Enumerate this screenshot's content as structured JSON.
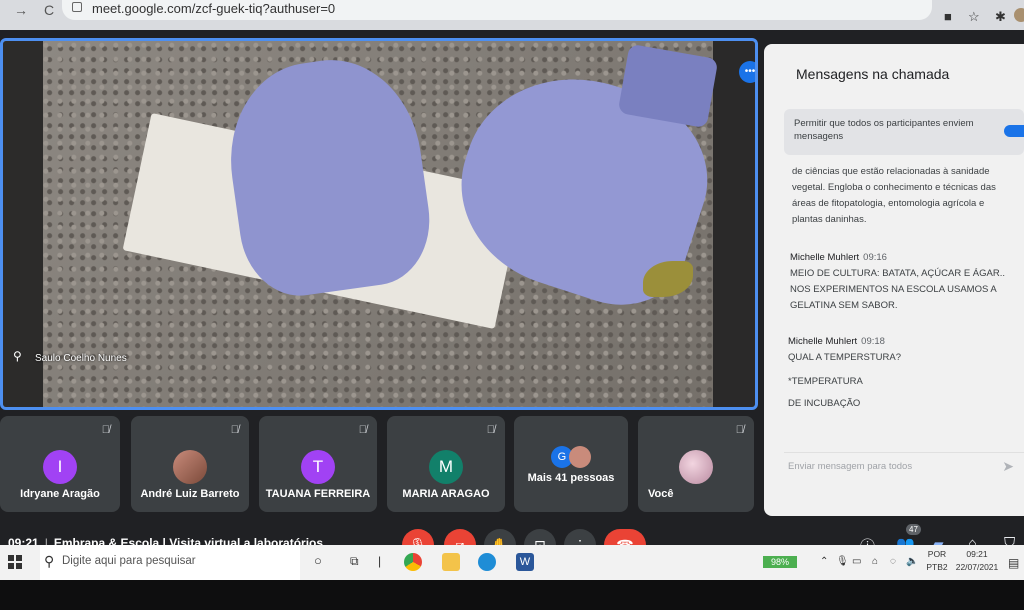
{
  "browser": {
    "url": "meet.google.com/zcf-guek-tiq?authuser=0",
    "icons": [
      "back-icon",
      "refresh-icon",
      "camera-icon",
      "star-icon",
      "extensions-icon",
      "profile-icon"
    ]
  },
  "main_video": {
    "speaker_name": "Saulo Coelho Nunes",
    "active_speaker_icon": "audio-bars-icon"
  },
  "participants": [
    {
      "name": "Idryane Aragão",
      "initial": "I",
      "avatar_color": "#a142f4",
      "muted": true
    },
    {
      "name": "André Luiz Barreto",
      "initial": "",
      "avatar_color": "photo",
      "muted": true
    },
    {
      "name": "TAUANA FERREIRA",
      "initial": "T",
      "avatar_color": "#a142f4",
      "muted": true
    },
    {
      "name": "MARIA ARAGAO",
      "initial": "M",
      "avatar_color": "#12806a",
      "muted": true
    },
    {
      "name": "Mais 41 pessoas",
      "initial": "G",
      "avatar_color": "#1a73e8",
      "muted": false
    },
    {
      "name": "Você",
      "initial": "",
      "avatar_color": "photo",
      "muted": true
    }
  ],
  "chat": {
    "title": "Mensagens na chamada",
    "permit_text": "Permitir que todos os participantes enviem mensagens",
    "permit_enabled": true,
    "earlier_text": "de ciências que estão relacionadas à sanidade vegetal. Engloba o conhecimento e técnicas das áreas de fitopatologia, entomologia agrícola e plantas daninhas.",
    "messages": [
      {
        "sender": "Michelle Muhlert",
        "time": "09:16",
        "lines": [
          "MEIO DE CULTURA: BATATA, AÇÚCAR E ÁGAR.. NOS EXPERIMENTOS NA ESCOLA USAMOS A GELATINA SEM SABOR."
        ]
      },
      {
        "sender": "Michelle Muhlert",
        "time": "09:18",
        "lines": [
          "QUAL A TEMPERSTURA?",
          "*TEMPERATURA",
          "DE INCUBAÇÃO"
        ]
      }
    ],
    "input_placeholder": "Enviar mensagem para todos"
  },
  "bottom_bar": {
    "time": "09:21",
    "meeting_title": "Embrapa & Escola | Visita virtual a laboratórios",
    "controls": [
      "mic-off-icon",
      "camera-off-icon",
      "raise-hand-icon",
      "present-icon",
      "more-icon",
      "end-call-icon"
    ],
    "participants_count": "47",
    "right_icons": [
      "info-icon",
      "people-icon",
      "chat-icon",
      "activities-icon",
      "lock-icon"
    ]
  },
  "taskbar": {
    "search_placeholder": "Digite aqui para pesquisar",
    "battery": "98%",
    "lang_top": "POR",
    "lang_bottom": "PTB2",
    "clock_time": "09:21",
    "clock_date": "22/07/2021"
  }
}
